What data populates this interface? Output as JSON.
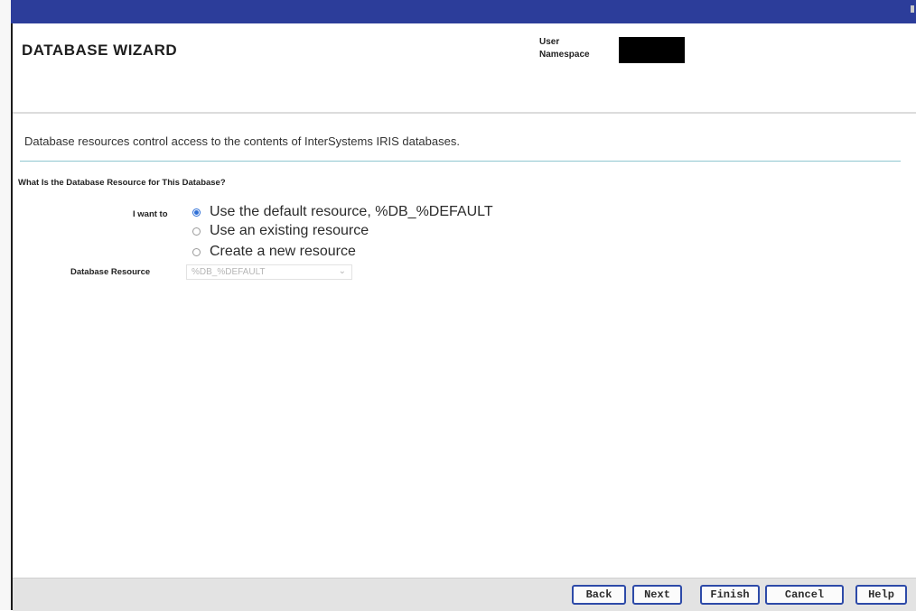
{
  "header": {
    "title": "DATABASE WIZARD",
    "user_label": "User",
    "namespace_label": "Namespace"
  },
  "main": {
    "description": "Database resources control access to the contents of InterSystems IRIS databases.",
    "section_heading": "What Is the Database Resource for This Database?",
    "i_want_to_label": "I want to",
    "options": [
      {
        "label": "Use the default resource, %DB_%DEFAULT",
        "checked": true
      },
      {
        "label": "Use an existing resource",
        "checked": false
      },
      {
        "label": "Create a new resource",
        "checked": false
      }
    ],
    "database_resource_label": "Database Resource",
    "database_resource_value": "%DB_%DEFAULT"
  },
  "footer": {
    "back": "Back",
    "next": "Next",
    "finish": "Finish",
    "cancel": "Cancel",
    "help": "Help"
  },
  "colors": {
    "title_bar": "#2c3d9a",
    "radio_selected": "#2f6fd6",
    "button_border": "#2d4aa8",
    "divider": "#8fc6d0"
  }
}
